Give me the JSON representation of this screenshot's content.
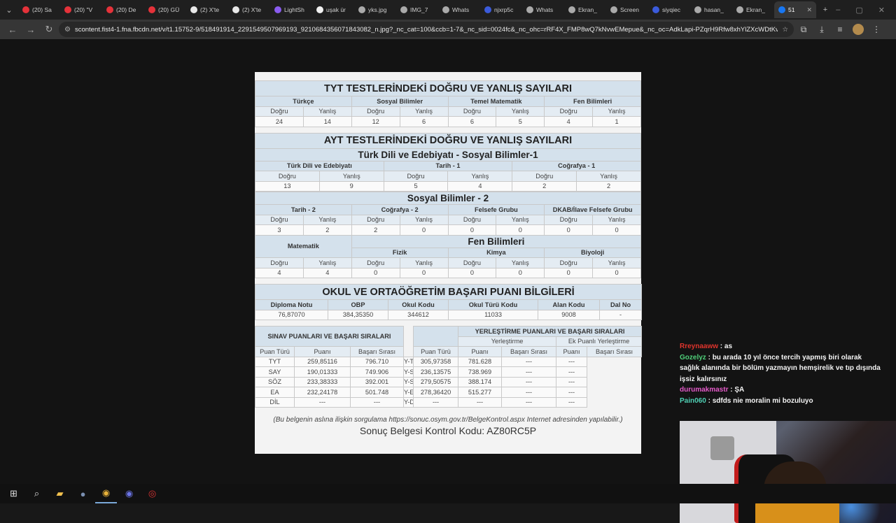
{
  "browser": {
    "tabs": [
      {
        "label": "(20) Sa",
        "color": "#e5323a"
      },
      {
        "label": "(20) \"V",
        "color": "#e5323a"
      },
      {
        "label": "(20) De",
        "color": "#e5323a"
      },
      {
        "label": "(20) GÜ",
        "color": "#e5323a"
      },
      {
        "label": "(2) X'te",
        "color": "#e8e8e8"
      },
      {
        "label": "(2) X'te",
        "color": "#e8e8e8"
      },
      {
        "label": "LightSh",
        "color": "#8a5cf0"
      },
      {
        "label": "uşak ür",
        "color": "#f0f0f0"
      },
      {
        "label": "yks.jpg",
        "color": "#aaaaaa"
      },
      {
        "label": "IMG_7",
        "color": "#aaaaaa"
      },
      {
        "label": "Whats",
        "color": "#aaaaaa"
      },
      {
        "label": "njxrp5c",
        "color": "#3b5bdb"
      },
      {
        "label": "Whats",
        "color": "#aaaaaa"
      },
      {
        "label": "Ekran_",
        "color": "#aaaaaa"
      },
      {
        "label": "Screen",
        "color": "#aaaaaa"
      },
      {
        "label": "siyqiec",
        "color": "#3b5bdb"
      },
      {
        "label": "hasan_",
        "color": "#aaaaaa"
      },
      {
        "label": "Ekran_",
        "color": "#aaaaaa"
      },
      {
        "label": "51",
        "color": "#1877f2",
        "active": true
      }
    ],
    "url": "scontent.fist4-1.fna.fbcdn.net/v/t1.15752-9/518491914_2291549507969193_921068435607184308​2_n.jpg?_nc_cat=100&ccb=1-7&_nc_sid=0024fc&_nc_ohc=rRF4X_FMP8wQ7kNvwEMepue&_nc_oc=AdkLapi-PZqrH9Rfw8xhYlZXcWDtKvIZlIEq8R..."
  },
  "doc": {
    "tyt_title": "TYT TESTLERİNDEKİ DOĞRU VE YANLIŞ SAYILARI",
    "tyt_subjects": [
      "Türkçe",
      "Sosyal Bilimler",
      "Temel Matematik",
      "Fen Bilimleri"
    ],
    "dogru": "Doğru",
    "yanlis": "Yanlış",
    "tyt_values": [
      "24",
      "14",
      "12",
      "6",
      "6",
      "5",
      "4",
      "1"
    ],
    "ayt_title": "AYT TESTLERİNDEKİ DOĞRU VE YANLIŞ SAYILARI",
    "ayt_sub1": "Türk Dili ve Edebiyatı - Sosyal Bilimler-1",
    "ayt1_subjects": [
      "Türk Dili ve Edebiyatı",
      "Tarih - 1",
      "Coğrafya - 1"
    ],
    "ayt1_values": [
      "13",
      "9",
      "5",
      "4",
      "2",
      "2"
    ],
    "ayt_sub2": "Sosyal Bilimler - 2",
    "ayt2_subjects": [
      "Tarih - 2",
      "Coğrafya - 2",
      "Felsefe Grubu",
      "DKAB/İlave Felsefe Grubu"
    ],
    "ayt2_values": [
      "3",
      "2",
      "2",
      "0",
      "0",
      "0",
      "0",
      "0"
    ],
    "matematik": "Matematik",
    "fen_title": "Fen Bilimleri",
    "fen_subjects": [
      "Fizik",
      "Kimya",
      "Biyoloji"
    ],
    "mat_fen_values": [
      "4",
      "4",
      "0",
      "0",
      "0",
      "0",
      "0",
      "0"
    ],
    "okul_title": "OKUL VE ORTAÖĞRETİM BAŞARI PUANI BİLGİLERİ",
    "okul_headers": [
      "Diploma Notu",
      "OBP",
      "Okul Kodu",
      "Okul Türü Kodu",
      "Alan Kodu",
      "Dal No"
    ],
    "okul_values": [
      "76,87070",
      "384,35350",
      "344612",
      "11033",
      "9008",
      "-"
    ],
    "sinav_title": "SINAV PUANLARI VE BAŞARI SIRALARI",
    "yer_title": "YERLEŞTİRME PUANLARI VE BAŞARI SIRALARI",
    "yer_sub": "Yerleştirme",
    "ek_sub": "Ek Puanlı Yerleştirme",
    "col_puan_turu": "Puan Türü",
    "col_puani": "Puanı",
    "col_basari": "Başarı Sırası",
    "sinav_rows": [
      [
        "TYT",
        "259,85116",
        "796.710"
      ],
      [
        "SAY",
        "190,01333",
        "749.906"
      ],
      [
        "SÖZ",
        "233,38333",
        "392.001"
      ],
      [
        "EA",
        "232,24178",
        "501.748"
      ],
      [
        "DİL",
        "---",
        "---"
      ]
    ],
    "yer_rows": [
      [
        "Y-TYT",
        "305,97358",
        "781.628",
        "---",
        "---"
      ],
      [
        "Y-SAY",
        "236,13575",
        "738.969",
        "---",
        "---"
      ],
      [
        "Y-SÖZ",
        "279,50575",
        "388.174",
        "---",
        "---"
      ],
      [
        "Y-EA",
        "278,36420",
        "515.277",
        "---",
        "---"
      ],
      [
        "Y-DİL",
        "---",
        "---",
        "---",
        "---"
      ]
    ],
    "note": "(Bu belgenin aslına ilişkin sorgulama https://sonuc.osym.gov.tr/BelgeKontrol.aspx Internet adresinden yapılabilir.)",
    "code": "Sonuç Belgesi Kontrol Kodu: AZ80RC5P"
  },
  "chat": [
    {
      "user": "Rreynaaww",
      "color": "#e0342c",
      "text": "as"
    },
    {
      "user": "Gozelyz",
      "color": "#4fd07a",
      "text": "bu arada 10 yıl önce tercih yapmış biri olarak sağlık alanında bir bölüm yazmayın hemşirelik ve tıp dışında işsiz kalırsınız"
    },
    {
      "user": "durumakmastr",
      "color": "#e35ac8",
      "text": "ŞA"
    },
    {
      "user": "Pain060",
      "color": "#4fd0b4",
      "text": "sdfds nie moralin mi bozuluyo"
    }
  ]
}
